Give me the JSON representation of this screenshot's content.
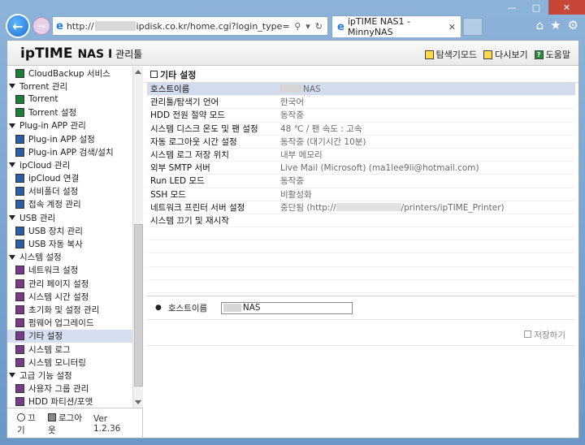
{
  "browser": {
    "url_prefix": "http://",
    "url_suffix": "ipdisk.co.kr/home.cgi?login_type=",
    "tab_title": "ipTIME NAS1 - MinnyNAS"
  },
  "header": {
    "logo_ip": "ip",
    "logo_time": "TIME",
    "logo_nas": "NAS I",
    "logo_admin": "관리툴",
    "links": [
      {
        "label": "탐색기모드"
      },
      {
        "label": "다시보기"
      },
      {
        "label": "도움말"
      }
    ]
  },
  "sidebar": {
    "rows": [
      {
        "type": "item",
        "label": "CloudBackup 서비스",
        "icon": "green"
      },
      {
        "type": "group",
        "label": "Torrent 관리"
      },
      {
        "type": "item",
        "label": "Torrent",
        "icon": "green"
      },
      {
        "type": "item",
        "label": "Torrent 설정",
        "icon": "green"
      },
      {
        "type": "group",
        "label": "Plug-in APP 관리"
      },
      {
        "type": "item",
        "label": "Plug-in APP 설정",
        "icon": "blue"
      },
      {
        "type": "item",
        "label": "Plug-in APP 검색/설치",
        "icon": "blue"
      },
      {
        "type": "group",
        "label": "ipCloud 관리"
      },
      {
        "type": "item",
        "label": "ipCloud 연결",
        "icon": "blue"
      },
      {
        "type": "item",
        "label": "서비폴더 설정",
        "icon": "blue"
      },
      {
        "type": "item",
        "label": "접속 계정 관리",
        "icon": "blue"
      },
      {
        "type": "group",
        "label": "USB 관리"
      },
      {
        "type": "item",
        "label": "USB 장치 관리",
        "icon": "blue"
      },
      {
        "type": "item",
        "label": "USB 자동 복사",
        "icon": "blue"
      },
      {
        "type": "group",
        "label": "시스템 설정"
      },
      {
        "type": "item",
        "label": "네트워크 설정",
        "icon": "purple"
      },
      {
        "type": "item",
        "label": "관리 페이지 설정",
        "icon": "purple"
      },
      {
        "type": "item",
        "label": "시스템 시간 설정",
        "icon": "purple"
      },
      {
        "type": "item",
        "label": "초기화 및 설정 관리",
        "icon": "purple"
      },
      {
        "type": "item",
        "label": "펌웨어 업그레이드",
        "icon": "purple"
      },
      {
        "type": "item",
        "label": "기타 설정",
        "icon": "purple",
        "selected": true
      },
      {
        "type": "item",
        "label": "시스템 로그",
        "icon": "purple"
      },
      {
        "type": "item",
        "label": "시스템 모니터링",
        "icon": "purple"
      },
      {
        "type": "group",
        "label": "고급 기능 설정"
      },
      {
        "type": "item",
        "label": "사용자 그룹 관리",
        "icon": "purple"
      },
      {
        "type": "item",
        "label": "HDD 파티션/포맷",
        "icon": "purple"
      }
    ],
    "power_label": "끄기",
    "logout_label": "로그아웃",
    "version": "Ver 1.2.36"
  },
  "main": {
    "title": "기타 설정",
    "settings": [
      {
        "key": "호스트이름",
        "value": "NAS",
        "blurred_prefix": true,
        "selected": true
      },
      {
        "key": "관리툴/탐색기 언어",
        "value": "한국어"
      },
      {
        "key": "HDD 전원 절약 모드",
        "value": "동작중"
      },
      {
        "key": "시스템 디스크 온도 및 팬 설정",
        "value": "48 ℃ / 팬 속도 : 고속"
      },
      {
        "key": "자동 로그아웃 시간 설정",
        "value": "동작중 (대기시간 10분)"
      },
      {
        "key": "시스템 로그 저장 위치",
        "value": "내부 메모리"
      },
      {
        "key": "외부 SMTP 서버",
        "value": "Live Mail (Microsoft) (ma1lee9li@hotmail.com)"
      },
      {
        "key": "Run LED 모드",
        "value": "동작중"
      },
      {
        "key": "SSH 모드",
        "value": "비활성화"
      },
      {
        "key": "네트워크 프린터 서버 설정",
        "value_prefix": "중단됨 (http://",
        "value_suffix": "/printers/ipTIME_Printer)"
      },
      {
        "key": "시스템 끄기 및 재시작",
        "value": ""
      }
    ],
    "edit": {
      "label": "호스트이름",
      "value": "NAS"
    },
    "save_label": "저장하기"
  }
}
